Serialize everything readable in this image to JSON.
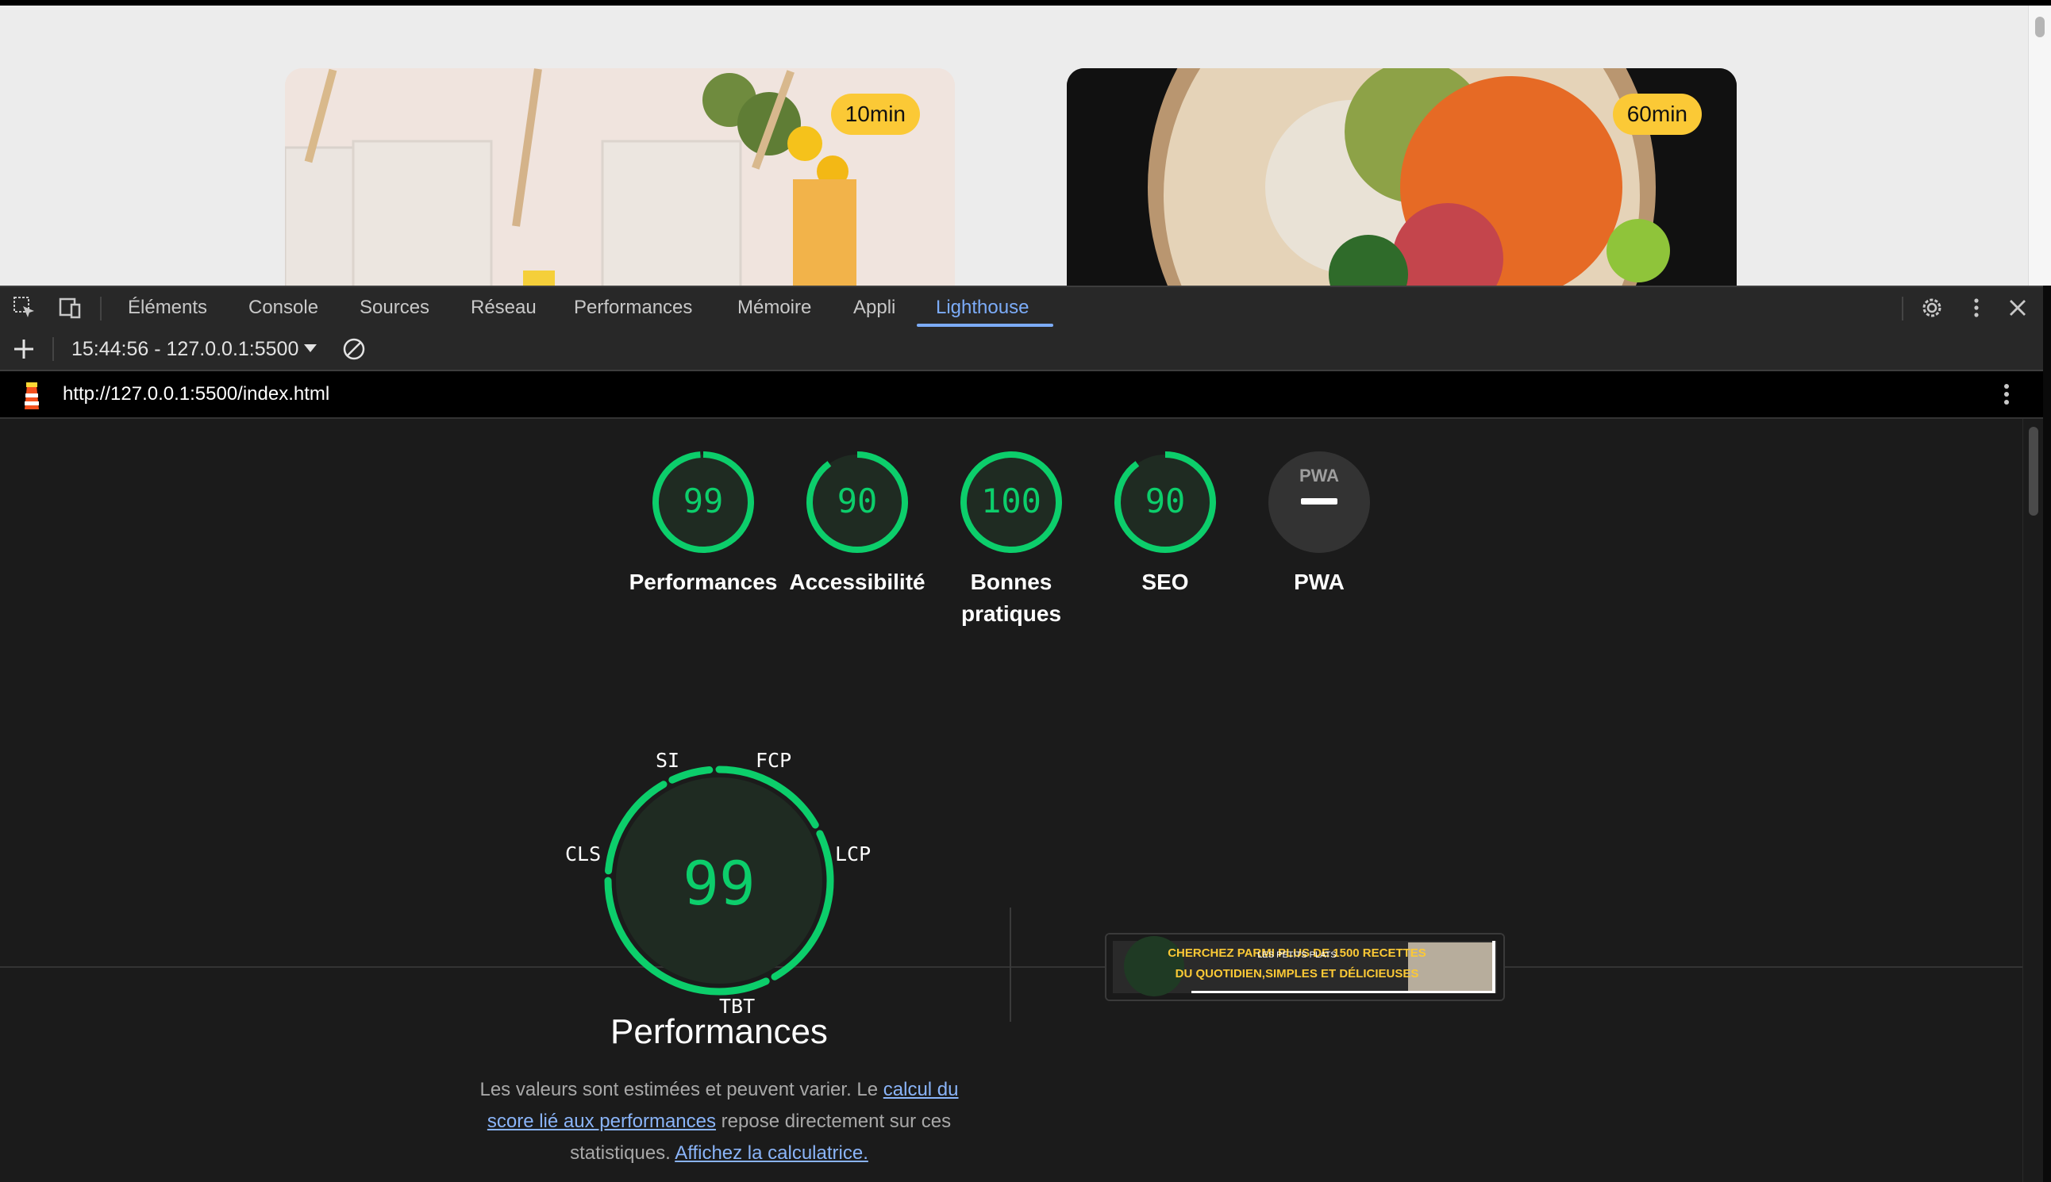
{
  "page": {
    "cards": [
      {
        "time": "10min"
      },
      {
        "time": "60min"
      }
    ]
  },
  "devtools": {
    "tabs": [
      "Éléments",
      "Console",
      "Sources",
      "Réseau",
      "Performances",
      "Mémoire",
      "Appli",
      "Lighthouse"
    ],
    "active_tab": "Lighthouse",
    "report_selector": "15:44:56 - 127.0.0.1:5500",
    "url": "http://127.0.0.1:5500/index.html"
  },
  "scores": [
    {
      "value": "99",
      "label": "Performances",
      "percent": 99
    },
    {
      "value": "90",
      "label": "Accessibilité",
      "percent": 90
    },
    {
      "value": "100",
      "label": "Bonnes pratiques",
      "percent": 100
    },
    {
      "value": "90",
      "label": "SEO",
      "percent": 90
    },
    {
      "value": "PWA",
      "label": "PWA",
      "percent": 0
    }
  ],
  "performance": {
    "score": "99",
    "title": "Performances",
    "metrics": [
      "SI",
      "FCP",
      "LCP",
      "TBT",
      "CLS"
    ],
    "description": "Les valeurs sont estimées et peuvent varier. Le",
    "link_calc": "calcul du score lié aux performances",
    "description_mid": "repose directement sur ces statistiques.",
    "link_calculator": "Affichez la calculatrice."
  },
  "screenshot": {
    "line1": "CHERCHEZ PARMI PLUS DE 1500 RECETTES",
    "line2": "DU QUOTIDIEN,SIMPLES ET DÉLICIEUSES",
    "overlap_text": "LES PETITS PLATS"
  },
  "colors": {
    "pass": "#0cce6b",
    "badge": "#fbc936",
    "link": "#8ab4f8"
  }
}
